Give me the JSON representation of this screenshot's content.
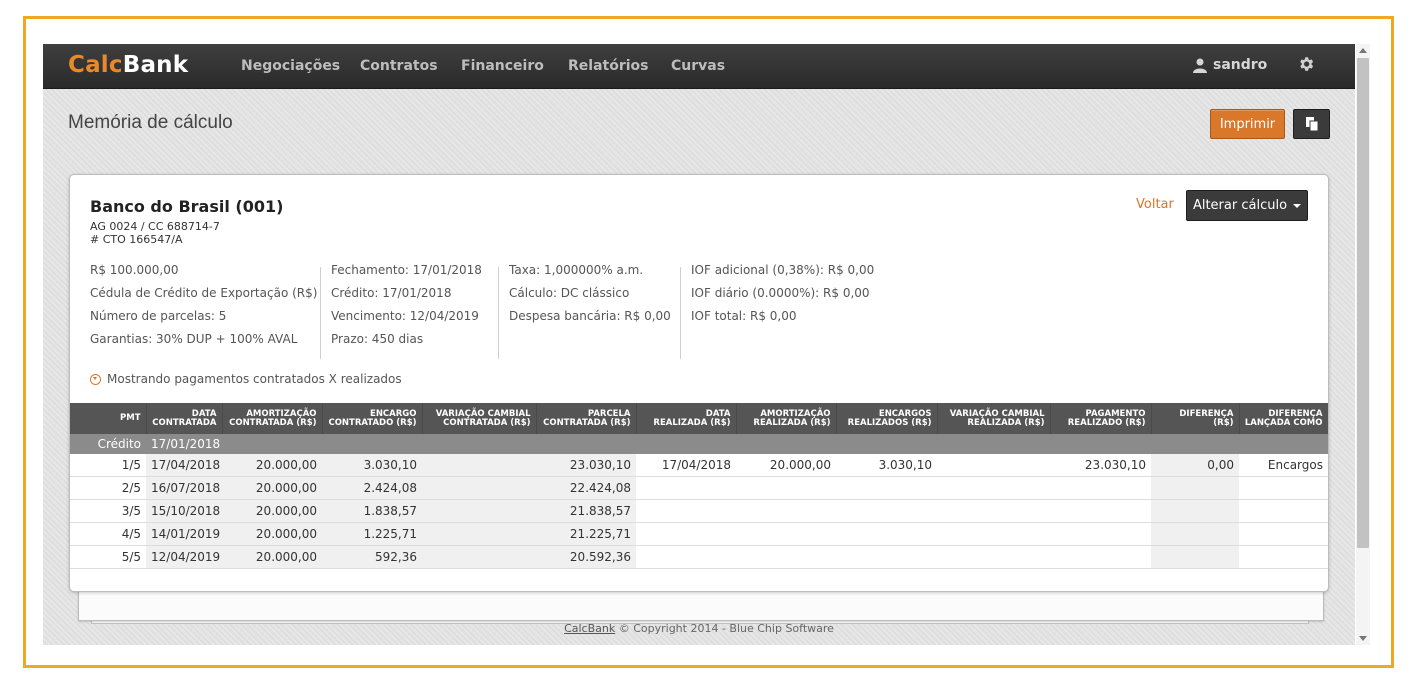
{
  "brand": {
    "part1": "Calc",
    "part2": "Bank"
  },
  "nav": [
    "Negociações",
    "Contratos",
    "Financeiro",
    "Relatórios",
    "Curvas"
  ],
  "user": {
    "name": "sandro"
  },
  "page_title": "Memória de cálculo",
  "buttons": {
    "print": "Imprimir",
    "back": "Voltar",
    "alter": "Alterar cálculo"
  },
  "bank": {
    "name": "Banco do Brasil (001)",
    "agency": "AG 0024 / CC 688714-7",
    "contract": "# CTO 166547/A"
  },
  "info": {
    "col1": [
      "R$ 100.000,00",
      "Cédula de Crédito de Exportação (R$)",
      "Número de parcelas: 5",
      "Garantias: 30% DUP + 100% AVAL"
    ],
    "col2": [
      "Fechamento: 17/01/2018",
      "Crédito: 17/01/2018",
      "Vencimento: 12/04/2019",
      "Prazo: 450 dias"
    ],
    "col3": [
      "Taxa: 1,000000% a.m.",
      "Cálculo: DC clássico",
      "Despesa bancária: R$ 0,00"
    ],
    "col4": [
      "IOF adicional (0,38%): R$ 0,00",
      "IOF diário (0.0000%): R$ 0,00",
      "IOF total: R$ 0,00"
    ]
  },
  "toggle_text": "Mostrando pagamentos contratados X realizados",
  "table": {
    "headers": [
      [
        "PMT"
      ],
      [
        "DATA",
        "CONTRATADA"
      ],
      [
        "AMORTIZAÇÃO",
        "CONTRATADA (R$)"
      ],
      [
        "ENCARGO",
        "CONTRATADO (R$)"
      ],
      [
        "VARIAÇÃO CAMBIAL",
        "CONTRATADA (R$)"
      ],
      [
        "PARCELA",
        "CONTRATADA (R$)"
      ],
      [
        "DATA",
        "REALIZADA (R$)"
      ],
      [
        "AMORTIZAÇÃO",
        "REALIZADA (R$)"
      ],
      [
        "ENCARGOS",
        "REALIZADOS (R$)"
      ],
      [
        "VARIAÇÃO CAMBIAL",
        "REALIZADA (R$)"
      ],
      [
        "PAGAMENTO",
        "REALIZADO (R$)"
      ],
      [
        "DIFERENÇA",
        "(R$)"
      ],
      [
        "DIFERENÇA",
        "LANÇADA COMO"
      ]
    ],
    "credit_row": [
      "Crédito",
      "17/01/2018",
      "",
      "",
      "",
      "",
      "",
      "",
      "",
      "",
      "",
      "",
      ""
    ],
    "rows": [
      [
        "1/5",
        "17/04/2018",
        "20.000,00",
        "3.030,10",
        "",
        "23.030,10",
        "17/04/2018",
        "20.000,00",
        "3.030,10",
        "",
        "23.030,10",
        "0,00",
        "Encargos"
      ],
      [
        "2/5",
        "16/07/2018",
        "20.000,00",
        "2.424,08",
        "",
        "22.424,08",
        "",
        "",
        "",
        "",
        "",
        "",
        ""
      ],
      [
        "3/5",
        "15/10/2018",
        "20.000,00",
        "1.838,57",
        "",
        "21.838,57",
        "",
        "",
        "",
        "",
        "",
        "",
        ""
      ],
      [
        "4/5",
        "14/01/2019",
        "20.000,00",
        "1.225,71",
        "",
        "21.225,71",
        "",
        "",
        "",
        "",
        "",
        "",
        ""
      ],
      [
        "5/5",
        "12/04/2019",
        "20.000,00",
        "592,36",
        "",
        "20.592,36",
        "",
        "",
        "",
        "",
        "",
        "",
        ""
      ]
    ]
  },
  "footer": {
    "link": "CalcBank",
    "text": "© Copyright 2014 - Blue Chip Software"
  },
  "colors": {
    "accent": "#d9772a",
    "frame": "#f0a824",
    "navbar": "#333333",
    "table_header": "#555555"
  }
}
